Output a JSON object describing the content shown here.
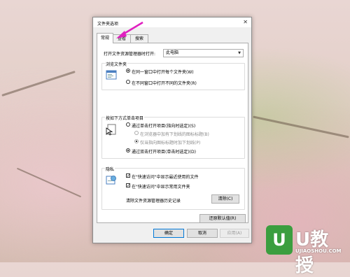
{
  "window": {
    "title": "文件夹选项"
  },
  "tabs": [
    {
      "label": "常规"
    },
    {
      "label": "查看"
    },
    {
      "label": "搜索"
    }
  ],
  "general": {
    "open_explorer_label": "打开文件资源管理器时打开:",
    "open_explorer_value": "此电脑",
    "browse_group_title": "浏览文件夹",
    "browse_same": "在同一窗口中打开每个文件夹(W)",
    "browse_new": "在不同窗口中打开不同的文件夹(R)",
    "click_group_title": "按如下方式单击项目",
    "single_click": "通过单击打开项目(指向时选定)(S)",
    "underline_browser": "在浏览器中加有下划线的图标标题(B)",
    "underline_hover": "仅当指向图标标题时加下划线(P)",
    "double_click": "通过双击打开项目(单击时选定)(D)",
    "privacy_group_title": "隐私",
    "show_recent": "在\"快速访问\"中显示最近使用的文件",
    "show_frequent": "在\"快速访问\"中显示常用文件夹",
    "clear_history_label": "清除文件资源管理器历史记录",
    "clear_button": "清除(C)",
    "restore_defaults": "还原默认值(R)"
  },
  "footer": {
    "ok": "确定",
    "cancel": "取消",
    "apply": "应用(A)"
  },
  "watermark": {
    "brand": "U教授",
    "url": "UJIAOSHOU.COM",
    "logo_letter": "U"
  },
  "colors": {
    "accent": "#0078d7",
    "arrow": "#e020c0",
    "logo_green": "#3b9e3f"
  }
}
